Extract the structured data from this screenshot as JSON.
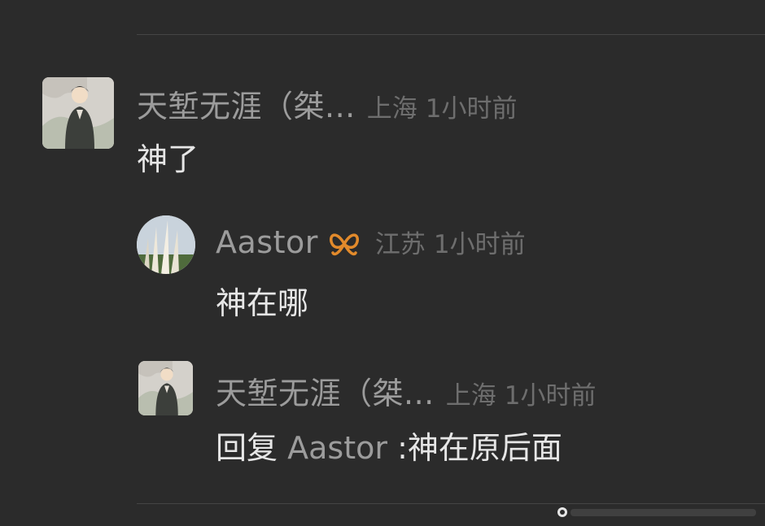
{
  "comments": [
    {
      "author": "天堑无涯（桀...",
      "location": "上海",
      "time": "1小时前",
      "text": "神了"
    },
    {
      "author": "Aastor",
      "location": "江苏",
      "time": "1小时前",
      "text": "神在哪",
      "badge_icon": "butterfly-badge-icon"
    },
    {
      "author": "天堑无涯（桀...",
      "location": "上海",
      "time": "1小时前",
      "reply_prefix": "回复",
      "reply_to": "Aastor",
      "text": ":神在原后面"
    }
  ],
  "colors": {
    "background": "#2b2b2b",
    "author": "#9c9c9c",
    "meta": "#6e6e6e",
    "body_text": "#e6e6e6",
    "badge": "#e28a2b"
  }
}
